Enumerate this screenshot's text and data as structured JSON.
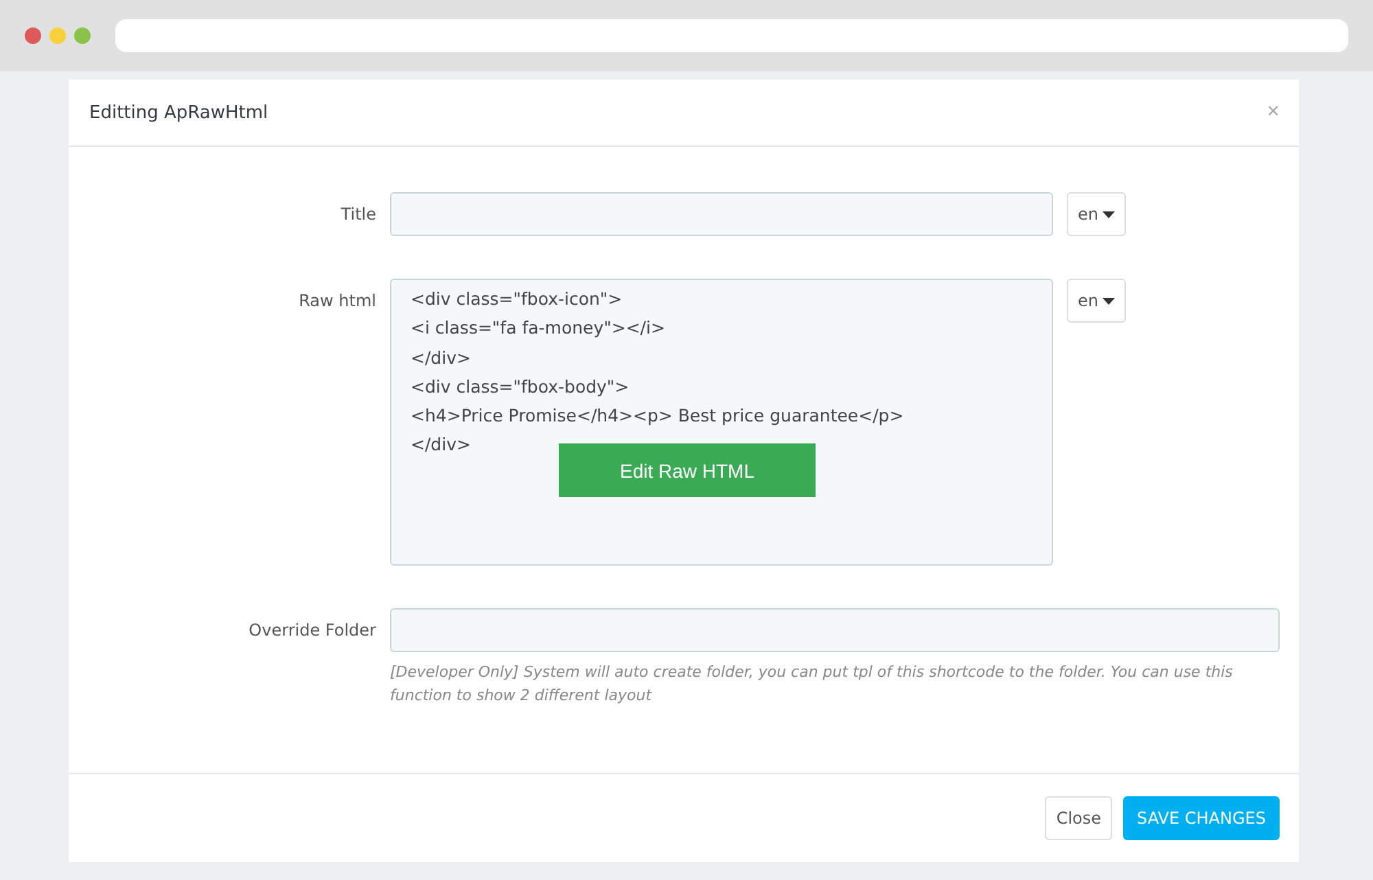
{
  "dialog": {
    "title": "Editting ApRawHtml",
    "close_glyph": "×"
  },
  "fields": [
    {
      "kind": "input",
      "label": "Title",
      "language": "en"
    },
    {
      "kind": "code",
      "label": "Raw html",
      "lines": [
        "<div class=\"fbox-icon\">",
        "<i class=\"fa fa-money\"></i>",
        "</div>",
        "<div class=\"fbox-body\">",
        "<h4>Price Promise</h4><p> Best price guarantee</p>",
        "</div>"
      ],
      "overlay_button": "Edit Raw HTML",
      "language": "en"
    },
    {
      "kind": "input",
      "label": "Override Folder",
      "help": "[Developer Only] System will auto create folder, you can put tpl of this shortcode to the folder. You can use this function to show 2 different layout"
    }
  ],
  "buttons": [
    {
      "label": "Close",
      "kind": "default"
    },
    {
      "label": "SAVE CHANGES",
      "kind": "primary"
    }
  ]
}
